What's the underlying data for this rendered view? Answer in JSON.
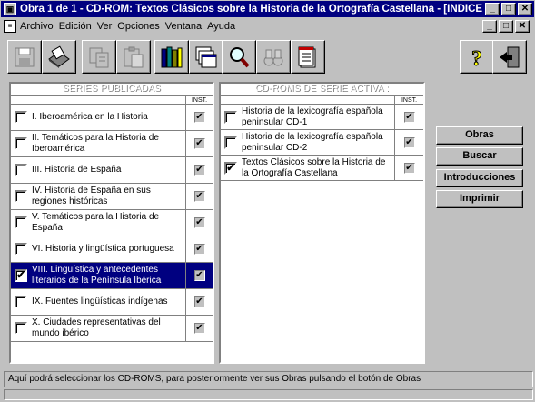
{
  "window": {
    "title": "Obra 1 de 1 - CD-ROM: Textos Clásicos sobre la Historia de la Ortografía Castellana - [INDICE ...",
    "controls": [
      "_",
      "□",
      "✕"
    ]
  },
  "menu": {
    "items": [
      "Archivo",
      "Edición",
      "Ver",
      "Opciones",
      "Ventana",
      "Ayuda"
    ],
    "doc_controls": [
      "_",
      "□",
      "✕"
    ]
  },
  "toolbar": {
    "icons": [
      "disk-icon",
      "printer-icon",
      "copy-icon",
      "paste-icon",
      "books-icon",
      "stack-icon",
      "magnifier-icon",
      "binoculars-icon",
      "index-icon",
      "help-icon",
      "exit-icon"
    ],
    "help_glyph": "?"
  },
  "left_panel": {
    "header": "SERIES PUBLICADAS",
    "inst_header": "INST.",
    "rows": [
      {
        "label": "I. Iberoamérica en la Historia",
        "checked": false,
        "inst": true,
        "selected": false
      },
      {
        "label": "II. Temáticos para la Historia de Iberoamérica",
        "checked": false,
        "inst": true,
        "selected": false
      },
      {
        "label": "III. Historia de España",
        "checked": false,
        "inst": true,
        "selected": false
      },
      {
        "label": "IV. Historia de España en sus regiones históricas",
        "checked": false,
        "inst": true,
        "selected": false
      },
      {
        "label": "V. Temáticos para la Historia de España",
        "checked": false,
        "inst": true,
        "selected": false
      },
      {
        "label": "VI. Historia y lingüística portuguesa",
        "checked": false,
        "inst": true,
        "selected": false
      },
      {
        "label": "VIII. Lingüística y antecedentes literarios de la Península Ibérica",
        "checked": true,
        "inst": true,
        "selected": true
      },
      {
        "label": "IX. Fuentes lingüísticas indígenas",
        "checked": false,
        "inst": true,
        "selected": false
      },
      {
        "label": "X. Ciudades representativas del mundo ibérico",
        "checked": false,
        "inst": true,
        "selected": false
      }
    ]
  },
  "right_panel": {
    "header": "CD-ROMS DE SERIE ACTIVA :",
    "inst_header": "INST.",
    "rows": [
      {
        "label": "Historia de la lexicografía española peninsular CD-1",
        "checked": false,
        "inst": true
      },
      {
        "label": "Historia de la lexicografía española peninsular CD-2",
        "checked": false,
        "inst": true
      },
      {
        "label": "Textos Clásicos sobre la Historia de la Ortografía Castellana",
        "checked": true,
        "inst": true
      }
    ]
  },
  "buttons": {
    "obras": "Obras",
    "buscar": "Buscar",
    "introducciones": "Introducciones",
    "imprimir": "Imprimir"
  },
  "status": {
    "text": "Aquí podrá seleccionar los CD-ROMS, para posteriormente ver sus Obras pulsando el botón de Obras"
  },
  "glyphs": {
    "check": "✔"
  }
}
